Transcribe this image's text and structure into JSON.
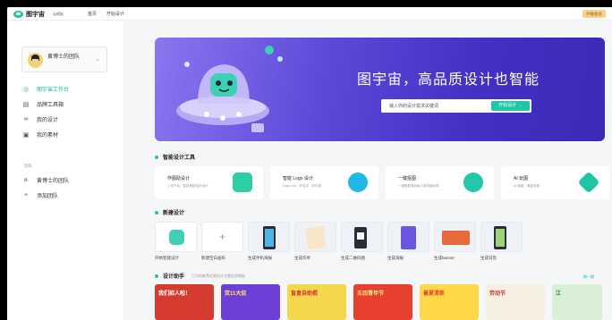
{
  "topbar": {
    "logo_text": "图宇宙",
    "logo_tag": "云模板",
    "nav": [
      "首页",
      "开始设计"
    ],
    "upgrade_label": "升级会员"
  },
  "sidebar": {
    "team_name": "黄博士的团队",
    "items": [
      {
        "label": "图宇宙工作台",
        "icon": "planet-icon",
        "active": true
      },
      {
        "label": "品牌工具箱",
        "icon": "toolbox-icon"
      },
      {
        "label": "我的设计",
        "icon": "link-icon"
      },
      {
        "label": "我的素材",
        "icon": "image-icon"
      }
    ],
    "section_title": "团队",
    "team_items": [
      {
        "label": "黄博士的团队",
        "icon": "team-icon"
      },
      {
        "label": "添加团队",
        "icon": "plus-icon"
      }
    ]
  },
  "banner": {
    "title": "图宇宙，高品质设计也智能",
    "search_placeholder": "输入你的设计需求关键词",
    "search_button": "开始设计 →"
  },
  "smart_tools": {
    "title": "智能设计工具",
    "items": [
      {
        "name": "作图助设计",
        "desc": "上传产品，智能搭配出好设计",
        "icon": "smart-design-icon",
        "color": "#2fcfa5"
      },
      {
        "name": "智能 Logo 设计",
        "desc": "Logo.Link，好名字，好形象",
        "icon": "logo-icon",
        "color": "#22b8e6"
      },
      {
        "name": "一键抠图",
        "desc": "一键抠取商品和人像背景轮廓",
        "icon": "cutout-icon",
        "color": "#23c7a9"
      },
      {
        "name": "AI 玩图",
        "desc": "AI 画图，海量风格",
        "icon": "ai-icon",
        "color": "#1fc5a3"
      }
    ]
  },
  "new_design": {
    "title": "新建设计",
    "items": [
      {
        "label": "开始智能设计",
        "icon": "robot-icon"
      },
      {
        "label": "新建空白画布",
        "icon": "plus-icon"
      },
      {
        "label": "生成手机海报",
        "icon": "phone-poster-icon"
      },
      {
        "label": "生成作单",
        "icon": "menu-icon"
      },
      {
        "label": "生成二维码图",
        "icon": "qrcode-icon"
      },
      {
        "label": "生成海报",
        "icon": "poster-icon"
      },
      {
        "label": "生成banner",
        "icon": "banner-icon"
      },
      {
        "label": "生成日签",
        "icon": "daily-icon"
      }
    ]
  },
  "assistant": {
    "title": "设计助手",
    "subtitle": "已为你推荐近期设计主题优质模板",
    "more": "换一换",
    "templates": [
      {
        "text": "我们招人啦！",
        "bg": "#d63b2f",
        "fg": "#fff"
      },
      {
        "text": "双11大促",
        "bg": "#6d3fd6",
        "fg": "#ffe36b"
      },
      {
        "text": "盲盒自助棍",
        "bg": "#f2d84a",
        "fg": "#d4302b"
      },
      {
        "text": "五四青年节",
        "bg": "#e8402f",
        "fg": "#ffe88a"
      },
      {
        "text": "暑夏清新",
        "bg": "#ffd84a",
        "fg": "#e0462c"
      },
      {
        "text": "劳动节",
        "bg": "#f6efe2",
        "fg": "#c4372e"
      },
      {
        "text": "江",
        "bg": "#d9f0d6",
        "fg": "#2f8a4a"
      }
    ]
  }
}
